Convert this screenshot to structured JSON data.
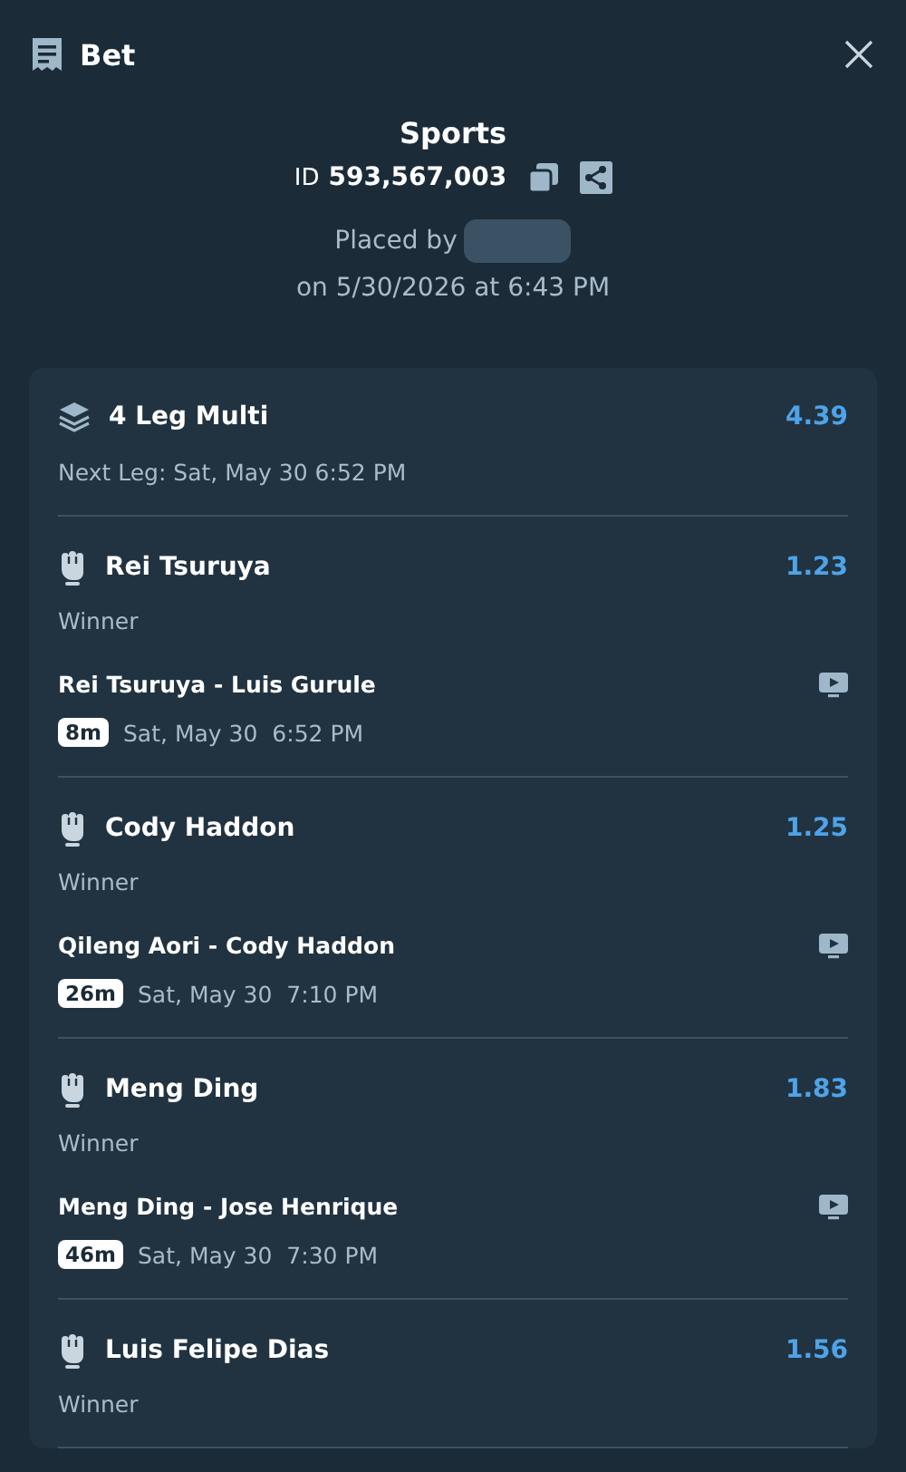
{
  "header": {
    "title": "Bet"
  },
  "summary": {
    "category": "Sports",
    "id_label": "ID",
    "id_value": "593,567,003",
    "placed_by": "Placed by",
    "placed_on": "on 5/30/2026 at 6:43 PM"
  },
  "multi": {
    "title": "4 Leg Multi",
    "odds": "4.39",
    "next_leg": "Next Leg: Sat, May 30 6:52 PM"
  },
  "legs": [
    {
      "name": "Rei Tsuruya",
      "odds": "1.23",
      "market": "Winner",
      "event": "Rei Tsuruya - Luis Gurule",
      "countdown": "8m",
      "date": "Sat, May 30",
      "time": "6:52 PM"
    },
    {
      "name": "Cody Haddon",
      "odds": "1.25",
      "market": "Winner",
      "event": "Qileng Aori - Cody Haddon",
      "countdown": "26m",
      "date": "Sat, May 30",
      "time": "7:10 PM"
    },
    {
      "name": "Meng Ding",
      "odds": "1.83",
      "market": "Winner",
      "event": "Meng Ding - Jose Henrique",
      "countdown": "46m",
      "date": "Sat, May 30",
      "time": "7:30 PM"
    },
    {
      "name": "Luis Felipe Dias",
      "odds": "1.56",
      "market": "Winner"
    }
  ]
}
